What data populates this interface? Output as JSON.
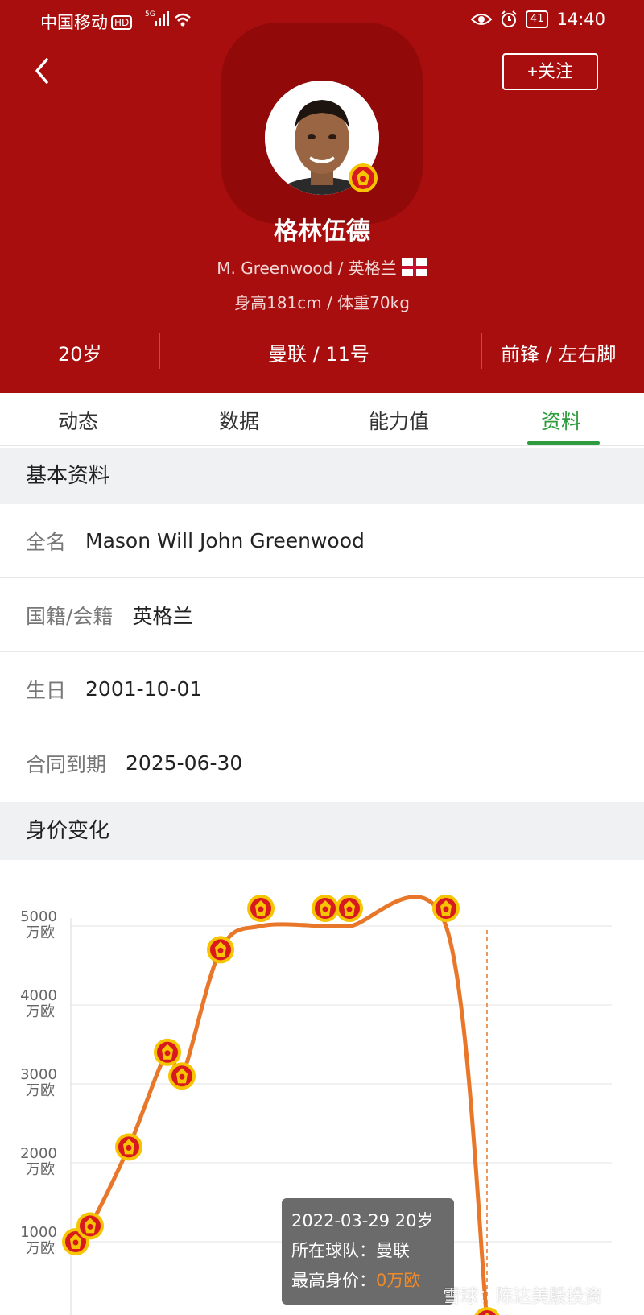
{
  "status_bar": {
    "carrier": "中国移动",
    "hd": "HD",
    "network": "5G",
    "battery": "41",
    "time": "14:40"
  },
  "header": {
    "follow_label": "+关注",
    "name_cn": "格林伍德",
    "name_line": "M. Greenwood / 英格兰",
    "body_line": "身高181cm / 体重70kg",
    "stats": [
      "20岁",
      "曼联 / 11号",
      "前锋 / 左右脚"
    ]
  },
  "tabs": [
    {
      "label": "动态"
    },
    {
      "label": "数据"
    },
    {
      "label": "能力值"
    },
    {
      "label": "资料",
      "active": true
    }
  ],
  "basic_info": {
    "title": "基本资料",
    "rows": [
      {
        "label": "全名",
        "value": "Mason Will John Greenwood"
      },
      {
        "label": "国籍/会籍",
        "value": "英格兰"
      },
      {
        "label": "生日",
        "value": "2001-10-01"
      },
      {
        "label": "合同到期",
        "value": "2025-06-30"
      }
    ]
  },
  "value_section": {
    "title": "身价变化"
  },
  "chart_data": {
    "type": "line",
    "y_unit": "万欧",
    "yticks": [
      "5000",
      "4000",
      "3000",
      "2000",
      "1000"
    ],
    "ylim": [
      0,
      5000
    ],
    "values": [
      1000,
      1200,
      2200,
      3400,
      3100,
      4700,
      5000,
      5000,
      5000,
      5000,
      0
    ],
    "grid": true,
    "line_color": "#e8772a",
    "tooltip": {
      "date_line": "2022-03-29 20岁",
      "team_label": "所在球队：",
      "team": "曼联",
      "value_label": "最高身价：",
      "value": "0万欧"
    }
  },
  "watermark": "雪球：陈达美股投资",
  "colors": {
    "header_bg": "#a80e0e",
    "active_tab": "#2e9b3e",
    "line": "#e8772a"
  }
}
